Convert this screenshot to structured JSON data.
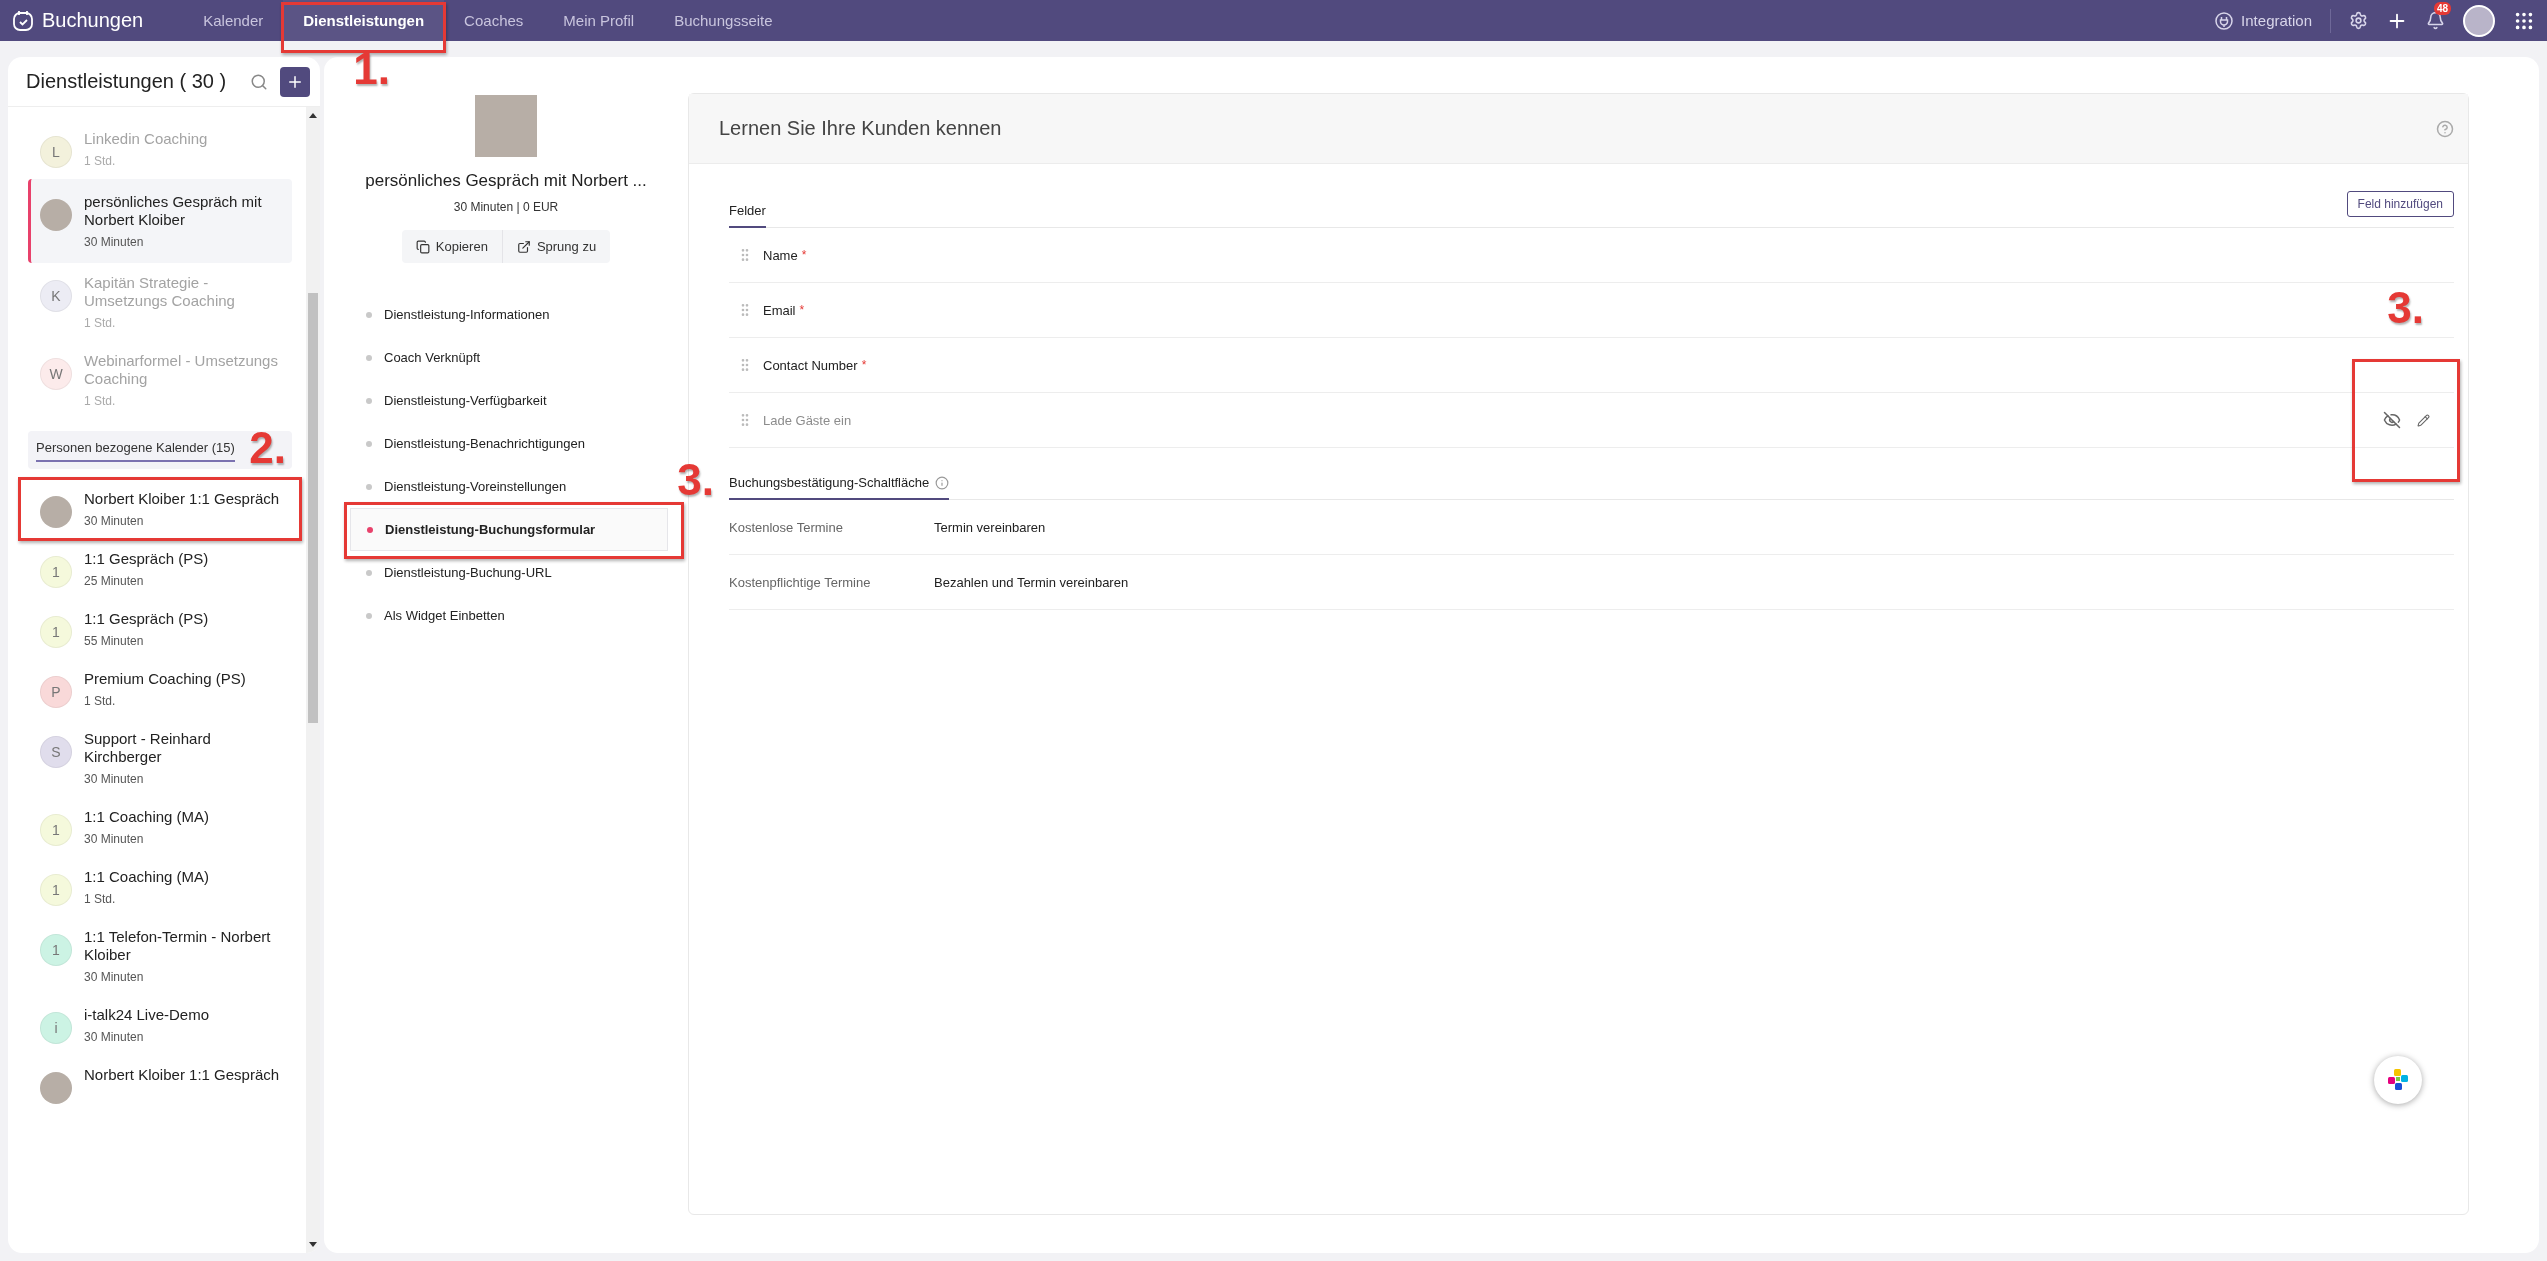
{
  "topbar": {
    "app_name": "Buchungen",
    "tabs": [
      {
        "label": "Kalender",
        "selected": false,
        "highlighted": false
      },
      {
        "label": "Dienstleistungen",
        "selected": true,
        "highlighted": true,
        "annotation": "1."
      },
      {
        "label": "Coaches",
        "selected": false,
        "highlighted": false
      },
      {
        "label": "Mein Profil",
        "selected": false,
        "highlighted": false
      },
      {
        "label": "Buchungsseite",
        "selected": false,
        "highlighted": false
      }
    ],
    "integration": "Integration",
    "notification_count": "48"
  },
  "sidebar": {
    "title": "Dienstleistungen ( 30 )",
    "items": [
      {
        "kind": "service",
        "title": "Linkedin Coaching",
        "duration": "1 Std.",
        "avatar": {
          "kind": "letter",
          "letter": "L",
          "color": "#f3f1dc"
        },
        "selected": false,
        "disabled": true,
        "highlighted": false
      },
      {
        "kind": "service",
        "title": "persönliches Gespräch mit Norbert Kloiber",
        "duration": "30 Minuten",
        "avatar": {
          "kind": "photo"
        },
        "selected": true,
        "disabled": false,
        "highlighted": false
      },
      {
        "kind": "service",
        "title": "Kapitän Strategie - Umsetzungs Coaching",
        "duration": "1 Std.",
        "avatar": {
          "kind": "letter",
          "letter": "K",
          "color": "#ececf4"
        },
        "selected": false,
        "disabled": true,
        "highlighted": false
      },
      {
        "kind": "service",
        "title": "Webinarformel - Umsetzungs Coaching",
        "duration": "1 Std.",
        "avatar": {
          "kind": "letter",
          "letter": "W",
          "color": "#fcebeb"
        },
        "selected": false,
        "disabled": true,
        "highlighted": false
      },
      {
        "kind": "group_header",
        "title": "Personen bezogene Kalender (15)",
        "annotation": "2."
      },
      {
        "kind": "service",
        "title": "Norbert Kloiber 1:1 Gespräch",
        "duration": "30 Minuten",
        "avatar": {
          "kind": "photo"
        },
        "selected": false,
        "disabled": false,
        "highlighted": true
      },
      {
        "kind": "service",
        "title": "1:1 Gespräch (PS)",
        "duration": "25 Minuten",
        "avatar": {
          "kind": "letter",
          "letter": "1",
          "color": "#f5f9dc"
        },
        "selected": false,
        "disabled": false,
        "highlighted": false
      },
      {
        "kind": "service",
        "title": "1:1 Gespräch (PS)",
        "duration": "55 Minuten",
        "avatar": {
          "kind": "letter",
          "letter": "1",
          "color": "#f5f9dc"
        },
        "selected": false,
        "disabled": false,
        "highlighted": false
      },
      {
        "kind": "service",
        "title": "Premium Coaching (PS)",
        "duration": "1 Std.",
        "avatar": {
          "kind": "letter",
          "letter": "P",
          "color": "#f9d9d9"
        },
        "selected": false,
        "disabled": false,
        "highlighted": false
      },
      {
        "kind": "service",
        "title": "Support - Reinhard Kirchberger",
        "duration": "30 Minuten",
        "avatar": {
          "kind": "letter",
          "letter": "S",
          "color": "#e0ddec"
        },
        "selected": false,
        "disabled": false,
        "highlighted": false
      },
      {
        "kind": "service",
        "title": "1:1 Coaching (MA)",
        "duration": "30 Minuten",
        "avatar": {
          "kind": "letter",
          "letter": "1",
          "color": "#f5f9dc"
        },
        "selected": false,
        "disabled": false,
        "highlighted": false
      },
      {
        "kind": "service",
        "title": "1:1 Coaching (MA)",
        "duration": "1 Std.",
        "avatar": {
          "kind": "letter",
          "letter": "1",
          "color": "#f5f9dc"
        },
        "selected": false,
        "disabled": false,
        "highlighted": false
      },
      {
        "kind": "service",
        "title": "1:1 Telefon-Termin - Norbert Kloiber",
        "duration": "30 Minuten",
        "avatar": {
          "kind": "letter",
          "letter": "1",
          "color": "#ccf3e4"
        },
        "selected": false,
        "disabled": false,
        "highlighted": false
      },
      {
        "kind": "service",
        "title": "i-talk24 Live-Demo",
        "duration": "30 Minuten",
        "avatar": {
          "kind": "letter",
          "letter": "i",
          "color": "#ccf3e4"
        },
        "selected": false,
        "disabled": false,
        "highlighted": false
      },
      {
        "kind": "service",
        "title": "Norbert Kloiber 1:1 Gespräch",
        "avatar": {
          "kind": "photo"
        },
        "selected": false,
        "disabled": false,
        "highlighted": false
      }
    ]
  },
  "service": {
    "title": "persönliches Gespräch mit Norbert ...",
    "meta": "30 Minuten | 0 EUR",
    "actions": [
      {
        "kind": "copy",
        "label": "Kopieren"
      },
      {
        "kind": "open",
        "label": "Sprung zu"
      }
    ],
    "nav": [
      {
        "label": "Dienstleistung-Informationen",
        "selected": false,
        "highlighted": false
      },
      {
        "label": "Coach Verknüpft",
        "selected": false,
        "highlighted": false
      },
      {
        "label": "Dienstleistung-Verfügbarkeit",
        "selected": false,
        "highlighted": false
      },
      {
        "label": "Dienstleistung-Benachrichtigungen",
        "selected": false,
        "highlighted": false
      },
      {
        "label": "Dienstleistung-Voreinstellungen",
        "selected": false,
        "highlighted": false,
        "annotation": "3."
      },
      {
        "label": "Dienstleistung-Buchungsformular",
        "selected": true,
        "highlighted": true
      },
      {
        "label": "Dienstleistung-Buchung-URL",
        "selected": false,
        "highlighted": false
      },
      {
        "label": "Als Widget Einbetten",
        "selected": false,
        "highlighted": false
      }
    ]
  },
  "form": {
    "title": "Lernen Sie Ihre Kunden kennen",
    "fields_tab": "Felder",
    "add_button": "Feld hinzufügen",
    "fields": [
      {
        "label": "Name",
        "required_mark": "*",
        "hidden": false,
        "highlighted": false
      },
      {
        "label": "Email",
        "required_mark": "*",
        "hidden": false,
        "highlighted": false
      },
      {
        "label": "Contact Number",
        "required_mark": "*",
        "hidden": false,
        "highlighted": false
      },
      {
        "label": "Lade Gäste ein",
        "hidden": true,
        "highlighted": true,
        "annotation": "3."
      }
    ],
    "button_section": "Buchungsbestätigung-Schaltfläche",
    "button_rows": [
      {
        "label": "Kostenlose Termine",
        "value": "Termin vereinbaren"
      },
      {
        "label": "Kostenpflichtige Termine",
        "value": "Bezahlen und Termin vereinbaren"
      }
    ]
  }
}
